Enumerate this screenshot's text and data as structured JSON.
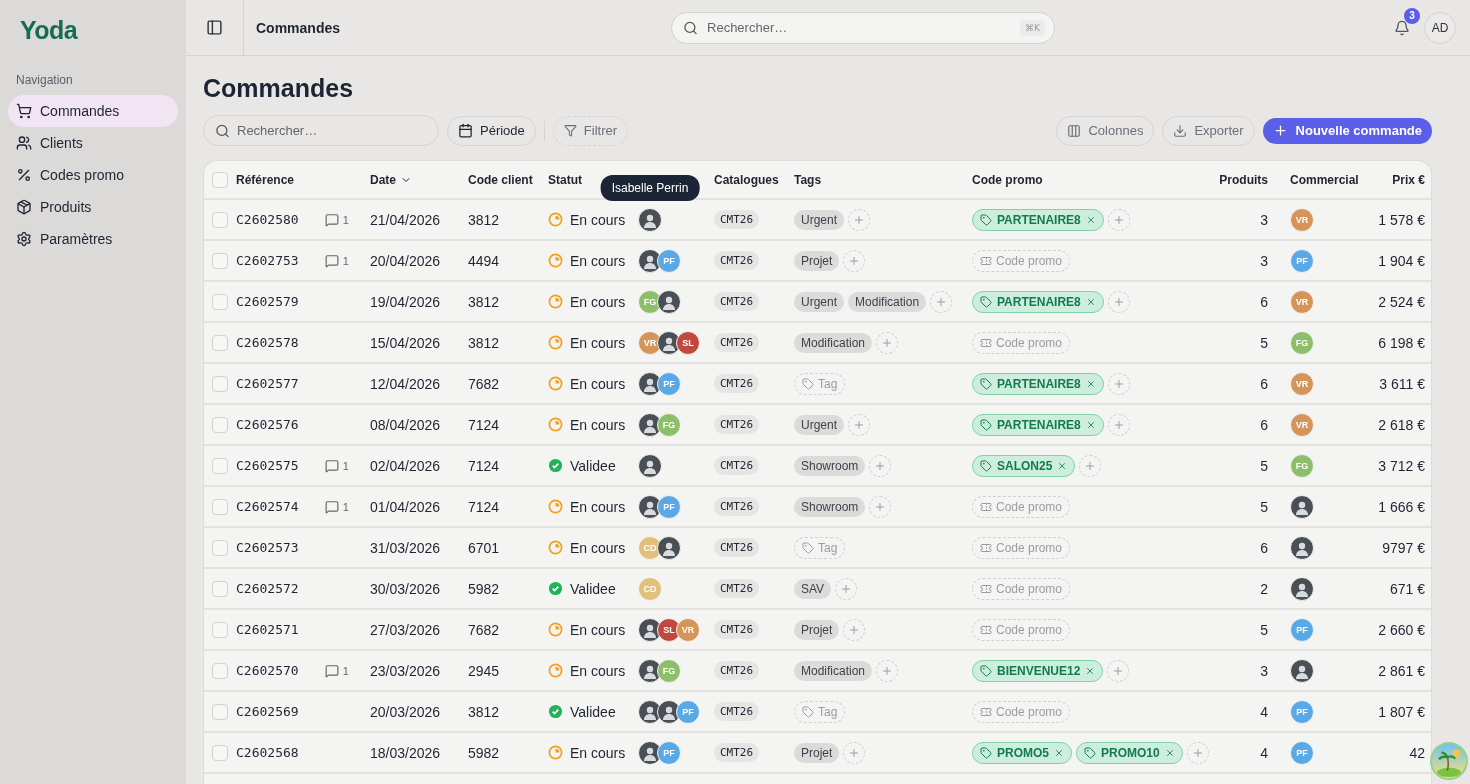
{
  "sidebar": {
    "logo": "Yoda",
    "section": "Navigation",
    "items": [
      {
        "label": "Commandes",
        "kind": "orders",
        "selected": true
      },
      {
        "label": "Clients",
        "kind": "clients",
        "selected": false
      },
      {
        "label": "Codes promo",
        "kind": "promo",
        "selected": false
      },
      {
        "label": "Produits",
        "kind": "products",
        "selected": false
      },
      {
        "label": "Paramètres",
        "kind": "settings",
        "selected": false
      }
    ]
  },
  "topbar": {
    "breadcrumb": "Commandes",
    "search": {
      "placeholder": "Rechercher…",
      "shortcut": "⌘K"
    },
    "notifications": "3",
    "user_initials": "AD"
  },
  "page": {
    "title": "Commandes",
    "search": {
      "placeholder": "Rechercher…"
    },
    "period_button": "Période",
    "filter_button": "Filtrer",
    "columns_button": "Colonnes",
    "export_button": "Exporter",
    "new_button": "Nouvelle commande"
  },
  "table": {
    "select_all_checked": false,
    "columns": [
      "Référence",
      "Date",
      "Code client",
      "Statut",
      "Catalogues",
      "Tags",
      "Code promo",
      "Produits",
      "Commercial",
      "Prix €"
    ],
    "rows": [
      {
        "checked": false,
        "reference": "C2602580",
        "comments": "1",
        "date": "21/04/2026",
        "client": "3812",
        "status": {
          "kind": "in_progress",
          "label": "En cours"
        },
        "avatars": [
          {
            "kind": "photo",
            "tooltip": "Isabelle Perrin"
          }
        ],
        "catalogue": "CMT26",
        "tags": [
          "Urgent"
        ],
        "promos": [
          "PARTENAIRE8"
        ],
        "products": "3",
        "commercial": {
          "kind": "initials",
          "initials": "VR",
          "color": "#d4945a"
        },
        "price": "1 578 €"
      },
      {
        "checked": false,
        "reference": "C2602753",
        "comments": "1",
        "date": "20/04/2026",
        "client": "4494",
        "status": {
          "kind": "in_progress",
          "label": "En cours"
        },
        "avatars": [
          {
            "kind": "photo"
          },
          {
            "kind": "initials",
            "initials": "PF",
            "color": "#5aa9e6"
          }
        ],
        "catalogue": "CMT26",
        "tags": [
          "Projet"
        ],
        "promos": [],
        "promo_placeholder": "Code promo",
        "products": "3",
        "commercial": {
          "kind": "initials",
          "initials": "PF",
          "color": "#5aa9e6"
        },
        "price": "1 904 €"
      },
      {
        "checked": false,
        "reference": "C2602579",
        "date": "19/04/2026",
        "client": "3812",
        "status": {
          "kind": "in_progress",
          "label": "En cours"
        },
        "avatars": [
          {
            "kind": "initials",
            "initials": "FG",
            "color": "#8dbf6b"
          },
          {
            "kind": "photo"
          }
        ],
        "catalogue": "CMT26",
        "tags": [
          "Urgent",
          "Modification"
        ],
        "promos": [
          "PARTENAIRE8"
        ],
        "products": "6",
        "commercial": {
          "kind": "initials",
          "initials": "VR",
          "color": "#d4945a"
        },
        "price": "2 524 €"
      },
      {
        "checked": false,
        "reference": "C2602578",
        "date": "15/04/2026",
        "client": "3812",
        "status": {
          "kind": "in_progress",
          "label": "En cours"
        },
        "avatars": [
          {
            "kind": "initials",
            "initials": "VR",
            "color": "#d4945a"
          },
          {
            "kind": "photo"
          },
          {
            "kind": "initials",
            "initials": "SL",
            "color": "#c0493f"
          }
        ],
        "catalogue": "CMT26",
        "tags": [
          "Modification"
        ],
        "promos": [],
        "promo_placeholder": "Code promo",
        "products": "5",
        "commercial": {
          "kind": "initials",
          "initials": "FG",
          "color": "#8dbf6b"
        },
        "price": "6 198 €"
      },
      {
        "checked": false,
        "reference": "C2602577",
        "date": "12/04/2026",
        "client": "7682",
        "status": {
          "kind": "in_progress",
          "label": "En cours"
        },
        "avatars": [
          {
            "kind": "photo"
          },
          {
            "kind": "initials",
            "initials": "PF",
            "color": "#5aa9e6"
          }
        ],
        "catalogue": "CMT26",
        "tags": [],
        "tag_placeholder": "Tag",
        "promos": [
          "PARTENAIRE8"
        ],
        "products": "6",
        "commercial": {
          "kind": "initials",
          "initials": "VR",
          "color": "#d4945a"
        },
        "price": "3 611 €"
      },
      {
        "checked": false,
        "reference": "C2602576",
        "date": "08/04/2026",
        "client": "7124",
        "status": {
          "kind": "in_progress",
          "label": "En cours"
        },
        "avatars": [
          {
            "kind": "photo"
          },
          {
            "kind": "initials",
            "initials": "FG",
            "color": "#8dbf6b"
          }
        ],
        "catalogue": "CMT26",
        "tags": [
          "Urgent"
        ],
        "promos": [
          "PARTENAIRE8"
        ],
        "products": "6",
        "commercial": {
          "kind": "initials",
          "initials": "VR",
          "color": "#d4945a"
        },
        "price": "2 618 €"
      },
      {
        "checked": false,
        "reference": "C2602575",
        "comments": "1",
        "date": "02/04/2026",
        "client": "7124",
        "status": {
          "kind": "done",
          "label": "Validee"
        },
        "avatars": [
          {
            "kind": "photo"
          }
        ],
        "catalogue": "CMT26",
        "tags": [
          "Showroom"
        ],
        "promos": [
          "SALON25"
        ],
        "products": "5",
        "commercial": {
          "kind": "initials",
          "initials": "FG",
          "color": "#8dbf6b"
        },
        "price": "3 712 €"
      },
      {
        "checked": false,
        "reference": "C2602574",
        "comments": "1",
        "date": "01/04/2026",
        "client": "7124",
        "status": {
          "kind": "in_progress",
          "label": "En cours"
        },
        "avatars": [
          {
            "kind": "photo"
          },
          {
            "kind": "initials",
            "initials": "PF",
            "color": "#5aa9e6"
          }
        ],
        "catalogue": "CMT26",
        "tags": [
          "Showroom"
        ],
        "promos": [],
        "promo_placeholder": "Code promo",
        "products": "5",
        "commercial": {
          "kind": "photo"
        },
        "price": "1 666 €"
      },
      {
        "checked": false,
        "reference": "C2602573",
        "date": "31/03/2026",
        "client": "6701",
        "status": {
          "kind": "in_progress",
          "label": "En cours"
        },
        "avatars": [
          {
            "kind": "initials",
            "initials": "CD",
            "color": "#e0c07a"
          },
          {
            "kind": "photo"
          }
        ],
        "catalogue": "CMT26",
        "tags": [],
        "tag_placeholder": "Tag",
        "promos": [],
        "promo_placeholder": "Code promo",
        "products": "6",
        "commercial": {
          "kind": "photo"
        },
        "price": "9797 €"
      },
      {
        "checked": false,
        "reference": "C2602572",
        "date": "30/03/2026",
        "client": "5982",
        "status": {
          "kind": "done",
          "label": "Validee"
        },
        "avatars": [
          {
            "kind": "initials",
            "initials": "CD",
            "color": "#e0c07a"
          }
        ],
        "catalogue": "CMT26",
        "tags": [
          "SAV"
        ],
        "promos": [],
        "promo_placeholder": "Code promo",
        "products": "2",
        "commercial": {
          "kind": "photo"
        },
        "price": "671 €"
      },
      {
        "checked": false,
        "reference": "C2602571",
        "date": "27/03/2026",
        "client": "7682",
        "status": {
          "kind": "in_progress",
          "label": "En cours"
        },
        "avatars": [
          {
            "kind": "photo"
          },
          {
            "kind": "initials",
            "initials": "SL",
            "color": "#c0493f"
          },
          {
            "kind": "initials",
            "initials": "VR",
            "color": "#d4945a"
          }
        ],
        "catalogue": "CMT26",
        "tags": [
          "Projet"
        ],
        "promos": [],
        "promo_placeholder": "Code promo",
        "products": "5",
        "commercial": {
          "kind": "initials",
          "initials": "PF",
          "color": "#5aa9e6"
        },
        "price": "2 660 €"
      },
      {
        "checked": false,
        "reference": "C2602570",
        "comments": "1",
        "date": "23/03/2026",
        "client": "2945",
        "status": {
          "kind": "in_progress",
          "label": "En cours"
        },
        "avatars": [
          {
            "kind": "photo"
          },
          {
            "kind": "initials",
            "initials": "FG",
            "color": "#8dbf6b"
          }
        ],
        "catalogue": "CMT26",
        "tags": [
          "Modification"
        ],
        "promos": [
          "BIENVENUE12"
        ],
        "products": "3",
        "commercial": {
          "kind": "photo"
        },
        "price": "2 861 €"
      },
      {
        "checked": false,
        "reference": "C2602569",
        "date": "20/03/2026",
        "client": "3812",
        "status": {
          "kind": "done",
          "label": "Validee"
        },
        "avatars": [
          {
            "kind": "photo"
          },
          {
            "kind": "photo"
          },
          {
            "kind": "initials",
            "initials": "PF",
            "color": "#5aa9e6"
          }
        ],
        "catalogue": "CMT26",
        "tags": [],
        "tag_placeholder": "Tag",
        "promos": [],
        "promo_placeholder": "Code promo",
        "products": "4",
        "commercial": {
          "kind": "initials",
          "initials": "PF",
          "color": "#5aa9e6"
        },
        "price": "1 807 €"
      },
      {
        "checked": false,
        "reference": "C2602568",
        "date": "18/03/2026",
        "client": "5982",
        "status": {
          "kind": "in_progress",
          "label": "En cours"
        },
        "avatars": [
          {
            "kind": "photo"
          },
          {
            "kind": "initials",
            "initials": "PF",
            "color": "#5aa9e6"
          }
        ],
        "catalogue": "CMT26",
        "tags": [
          "Projet"
        ],
        "promos": [
          "PROMO5",
          "PROMO10"
        ],
        "products": "4",
        "commercial": {
          "kind": "initials",
          "initials": "PF",
          "color": "#5aa9e6"
        },
        "price": "42"
      }
    ]
  }
}
